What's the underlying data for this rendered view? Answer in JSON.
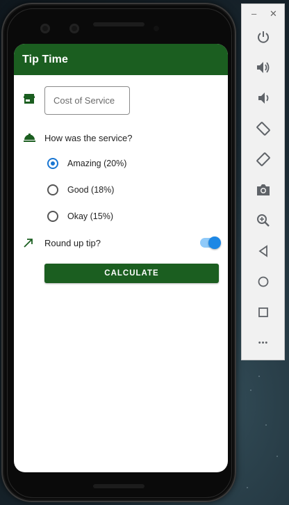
{
  "app": {
    "title": "Tip Time"
  },
  "form": {
    "cost_placeholder": "Cost of Service",
    "question": "How was the service?",
    "options": [
      {
        "label": "Amazing (20%)",
        "selected": true
      },
      {
        "label": "Good (18%)",
        "selected": false
      },
      {
        "label": "Okay (15%)",
        "selected": false
      }
    ],
    "round_up_label": "Round up tip?",
    "round_up_on": true,
    "calculate_label": "CALCULATE"
  },
  "colors": {
    "primary": "#1b5e20",
    "accent": "#1976d2"
  },
  "emulator_panel": {
    "window_controls": [
      "minimize-icon",
      "close-icon"
    ],
    "minimize_glyph": "–",
    "close_glyph": "✕",
    "buttons": [
      "power-icon",
      "volume-up-icon",
      "volume-down-icon",
      "rotate-left-icon",
      "rotate-right-icon",
      "camera-icon",
      "zoom-icon",
      "back-icon",
      "home-icon",
      "overview-icon",
      "more-icon"
    ],
    "more_glyph": "•••"
  }
}
